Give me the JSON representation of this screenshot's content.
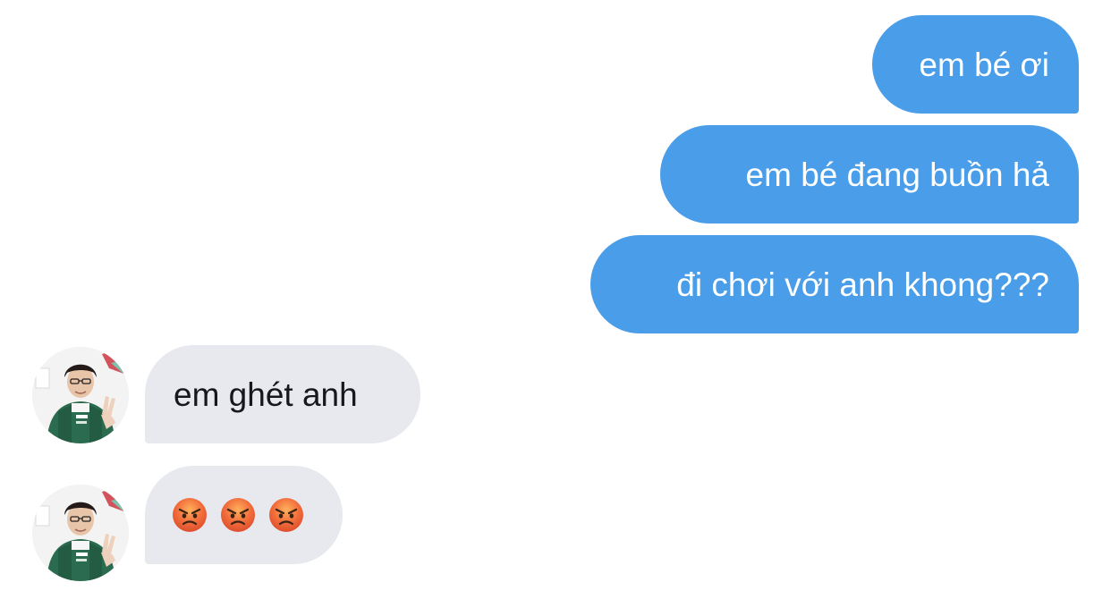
{
  "conversation": {
    "sent_messages": [
      {
        "text": "em bé ơi"
      },
      {
        "text": "em bé đang buồn hả"
      },
      {
        "text": "đi chơi với anh khong???"
      }
    ],
    "received_messages": [
      {
        "text": "em ghét anh"
      },
      {
        "emojis": [
          "angry-face-emoji",
          "angry-face-emoji",
          "angry-face-emoji"
        ]
      }
    ]
  },
  "colors": {
    "sent_bubble": "#4a9de8",
    "received_bubble": "#e7e9ee",
    "received_text": "#16181c",
    "background": "#ffffff"
  }
}
